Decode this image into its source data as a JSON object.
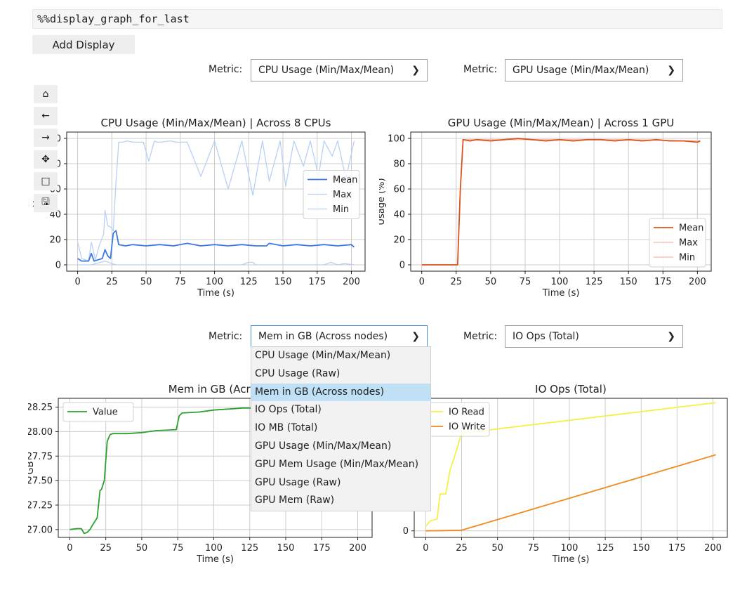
{
  "cell": {
    "code": "%%display_graph_for_last"
  },
  "add_display_label": "Add Display",
  "metric_label": "Metric:",
  "selects": [
    {
      "value": "CPU Usage (Min/Max/Mean)"
    },
    {
      "value": "GPU Usage (Min/Max/Mean)"
    },
    {
      "value": "Mem in GB (Across nodes)"
    },
    {
      "value": "IO Ops (Total)"
    }
  ],
  "dropdown_options": [
    "CPU Usage (Min/Max/Mean)",
    "CPU Usage (Raw)",
    "Mem in GB (Across nodes)",
    "IO Ops (Total)",
    "IO MB (Total)",
    "GPU Usage (Min/Max/Mean)",
    "GPU Mem Usage (Min/Max/Mean)",
    "GPU Usage (Raw)",
    "GPU Mem (Raw)"
  ],
  "dropdown_selected_index": 2,
  "toolbar_icons": [
    "home-icon",
    "back-arrow-icon",
    "forward-arrow-icon",
    "pan-move-icon",
    "zoom-rect-icon",
    "save-disk-icon"
  ],
  "chart_data": [
    {
      "type": "line",
      "title": "CPU Usage (Min/Max/Mean) | Across 8 CPUs",
      "xlabel": "Time (s)",
      "ylabel": "Us",
      "xlim": [
        -8,
        210
      ],
      "ylim": [
        -5,
        105
      ],
      "xticks": [
        0,
        25,
        50,
        75,
        100,
        125,
        150,
        175,
        200
      ],
      "yticks": [
        0,
        20,
        40,
        60,
        80,
        100
      ],
      "grid": true,
      "legend_position": "center-right",
      "series": [
        {
          "name": "Mean",
          "color": "#3b78e7",
          "width": 1.8,
          "x": [
            0,
            3,
            8,
            10,
            12,
            15,
            18,
            20,
            22,
            24,
            26,
            28,
            30,
            35,
            40,
            50,
            60,
            70,
            80,
            90,
            100,
            110,
            120,
            130,
            138,
            140,
            150,
            160,
            170,
            180,
            190,
            200,
            202
          ],
          "y": [
            5,
            3,
            3,
            9,
            3,
            4,
            5,
            12,
            7,
            5,
            25,
            27,
            16,
            15,
            16,
            15,
            16,
            15,
            17,
            15,
            16,
            15,
            16,
            15,
            15,
            17,
            15,
            16,
            15,
            16,
            15,
            16,
            14
          ]
        },
        {
          "name": "Max",
          "color": "#b8d0f5",
          "width": 1.3,
          "x": [
            0,
            3,
            8,
            10,
            13,
            16,
            19,
            20,
            22,
            24,
            26,
            28,
            30,
            33,
            36,
            40,
            48,
            52,
            56,
            58,
            60,
            68,
            72,
            76,
            80,
            90,
            100,
            110,
            120,
            128,
            135,
            140,
            148,
            152,
            158,
            165,
            170,
            176,
            180,
            186,
            190,
            196,
            202
          ],
          "y": [
            18,
            5,
            3,
            18,
            4,
            16,
            24,
            43,
            31,
            30,
            27,
            65,
            97,
            97,
            98,
            97,
            97,
            82,
            98,
            97,
            97,
            98,
            97,
            97,
            97,
            70,
            98,
            60,
            98,
            55,
            98,
            66,
            98,
            62,
            98,
            78,
            98,
            70,
            98,
            86,
            98,
            68,
            98
          ]
        },
        {
          "name": "Min",
          "color": "#b8d0f5",
          "width": 1.3,
          "x": [
            0,
            10,
            20,
            25,
            28,
            30,
            40,
            60,
            80,
            100,
            120,
            125,
            128,
            130,
            140,
            150,
            180,
            185,
            190,
            195,
            202
          ],
          "y": [
            0,
            0,
            3,
            1,
            0,
            0,
            0,
            0,
            0,
            0,
            0,
            2,
            2,
            0,
            0,
            0,
            0,
            2,
            0,
            1,
            0
          ]
        }
      ]
    },
    {
      "type": "line",
      "title": "GPU Usage (Min/Max/Mean) | Across 1 GPU",
      "xlabel": "Time (s)",
      "ylabel": "Usage (%)",
      "xlim": [
        -8,
        210
      ],
      "ylim": [
        -5,
        105
      ],
      "xticks": [
        0,
        25,
        50,
        75,
        100,
        125,
        150,
        175,
        200
      ],
      "yticks": [
        0,
        20,
        40,
        60,
        80,
        100
      ],
      "grid": true,
      "legend_position": "lower-right",
      "series": [
        {
          "name": "Mean",
          "color": "#d9541e",
          "width": 1.8,
          "x": [
            0,
            26,
            28,
            30,
            35,
            40,
            50,
            60,
            70,
            80,
            90,
            100,
            110,
            120,
            130,
            140,
            150,
            160,
            170,
            180,
            190,
            200,
            202
          ],
          "y": [
            0,
            0,
            60,
            99,
            98,
            99,
            98,
            99,
            100,
            99,
            98,
            99,
            98,
            99,
            99,
            98,
            99,
            98,
            99,
            98,
            98,
            97,
            98
          ]
        },
        {
          "name": "Max",
          "color": "#f7b9a4",
          "width": 1.3,
          "x": [
            0,
            26,
            28,
            30,
            60,
            100,
            150,
            202
          ],
          "y": [
            0,
            0,
            60,
            99,
            99,
            99,
            99,
            98
          ]
        },
        {
          "name": "Min",
          "color": "#f7b9a4",
          "width": 1.3,
          "x": [
            0,
            26,
            28,
            30,
            60,
            100,
            150,
            202
          ],
          "y": [
            0,
            0,
            60,
            99,
            99,
            99,
            99,
            98
          ]
        }
      ]
    },
    {
      "type": "line",
      "title": "Mem in GB (Acros",
      "xlabel": "Time (s)",
      "ylabel": "GB",
      "xlim": [
        -8,
        210
      ],
      "ylim": [
        26.92,
        28.34
      ],
      "xticks": [
        0,
        25,
        50,
        75,
        100,
        125,
        150,
        175,
        200
      ],
      "yticks": [
        27.0,
        27.25,
        27.5,
        27.75,
        28.0,
        28.25
      ],
      "ytick_labels": [
        "27.00",
        "27.25",
        "27.50",
        "27.75",
        "28.00",
        "28.25"
      ],
      "grid": true,
      "legend_position": "upper-left",
      "series": [
        {
          "name": "Value",
          "color": "#2ca02c",
          "width": 1.8,
          "x": [
            0,
            5,
            8,
            10,
            12,
            14,
            16,
            19,
            21,
            22,
            24,
            26,
            28,
            30,
            40,
            50,
            55,
            60,
            74,
            76,
            78,
            90,
            100,
            110,
            120,
            140,
            150,
            180,
            202
          ],
          "y": [
            27.0,
            27.01,
            27.01,
            26.96,
            26.97,
            27.0,
            27.05,
            27.12,
            27.4,
            27.41,
            27.5,
            27.9,
            27.97,
            27.98,
            27.98,
            27.99,
            28.0,
            28.01,
            28.02,
            28.16,
            28.19,
            28.2,
            28.22,
            28.23,
            28.24,
            28.24,
            28.25,
            28.25,
            28.25
          ]
        }
      ]
    },
    {
      "type": "line",
      "title": "IO Ops (Total)",
      "xlabel": "Time (s)",
      "ylabel": "",
      "xlim": [
        -8,
        210
      ],
      "ylim": [
        -300,
        6100
      ],
      "xticks": [
        0,
        25,
        50,
        75,
        100,
        125,
        150,
        175,
        200
      ],
      "yticks": [
        0
      ],
      "grid": true,
      "legend_position": "upper-left",
      "series": [
        {
          "name": "IO Read",
          "color": "#f4f045",
          "width": 1.8,
          "x": [
            0,
            3,
            8,
            10,
            14,
            17,
            20,
            24,
            26,
            202
          ],
          "y": [
            200,
            450,
            550,
            1700,
            1700,
            2800,
            3400,
            4300,
            4500,
            5900
          ]
        },
        {
          "name": "IO Write",
          "color": "#f08a1e",
          "width": 1.8,
          "x": [
            0,
            25,
            202
          ],
          "y": [
            0,
            30,
            3500
          ]
        }
      ]
    }
  ]
}
